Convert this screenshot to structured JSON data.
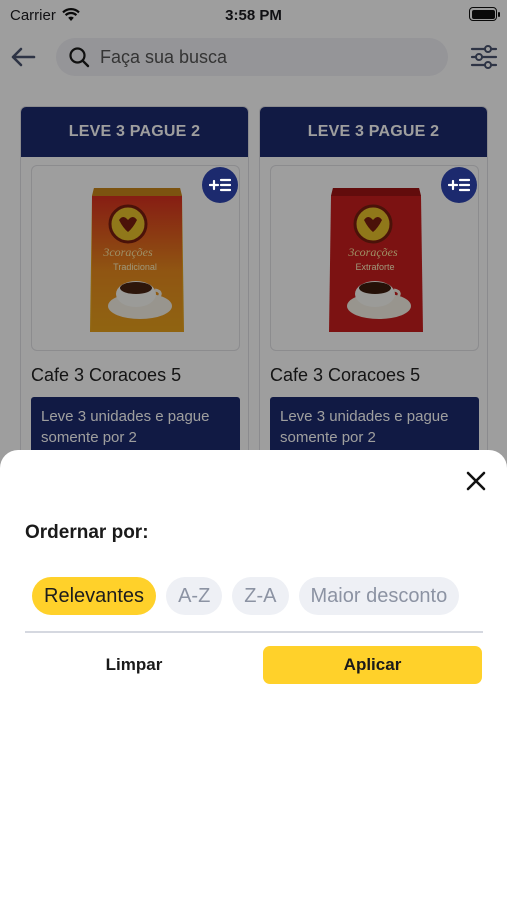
{
  "status_bar": {
    "carrier": "Carrier",
    "time": "3:58 PM"
  },
  "search": {
    "placeholder": "Faça sua busca"
  },
  "products": [
    {
      "promo_title": "LEVE 3 PAGUE 2",
      "name": "Cafe 3 Coracoes 5",
      "promo_text": "Leve 3 unidades e pague somente por 2",
      "package": {
        "brand": "3corações",
        "variant": "Tradicional",
        "color": "#e8a21c"
      }
    },
    {
      "promo_title": "LEVE 3 PAGUE 2",
      "name": "Cafe 3 Coracoes 5",
      "promo_text": "Leve 3 unidades e pague somente por 2",
      "package": {
        "brand": "3corações",
        "variant": "Extraforte",
        "color": "#c81e1e"
      }
    }
  ],
  "sort_sheet": {
    "title": "Ordernar por:",
    "options": [
      "Relevantes",
      "A-Z",
      "Z-A",
      "Maior desconto"
    ],
    "selected": "Relevantes",
    "clear_label": "Limpar",
    "apply_label": "Aplicar"
  },
  "colors": {
    "primary": "#1c2a6e",
    "accent": "#ffd12a",
    "chip_bg": "#eef0f5"
  }
}
